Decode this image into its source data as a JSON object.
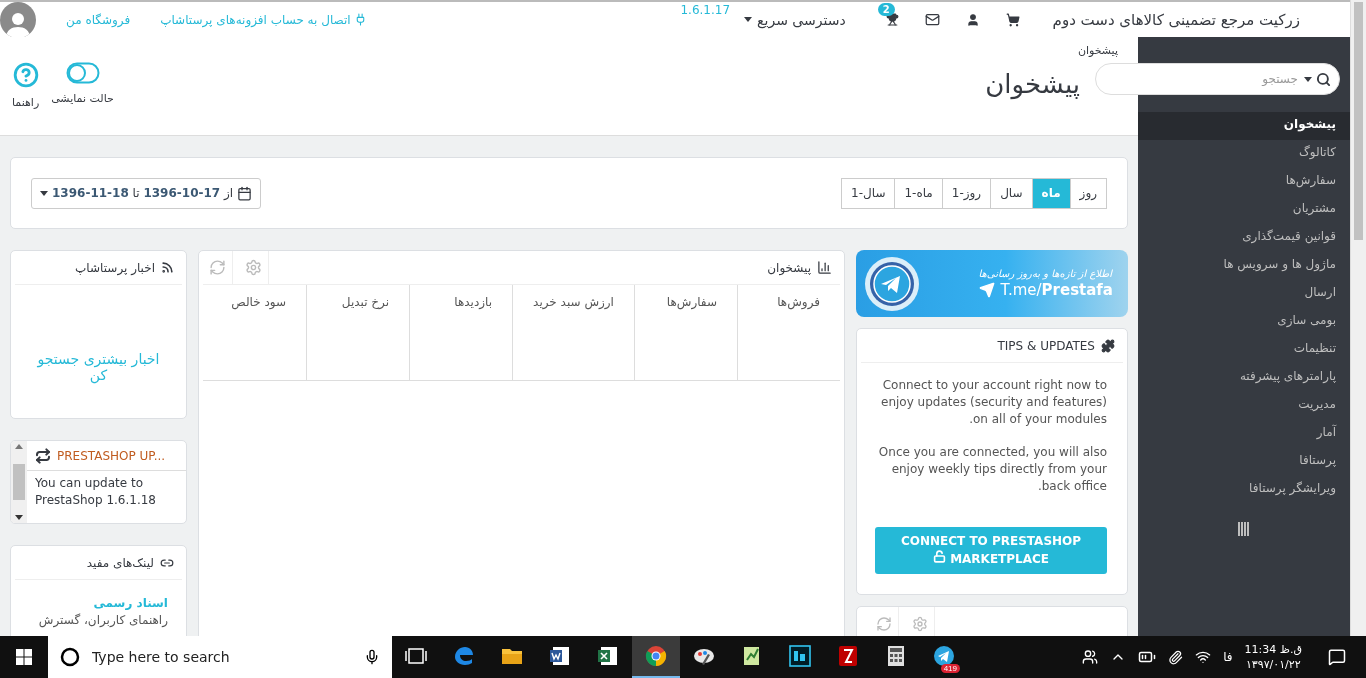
{
  "header": {
    "shop_name": "زرکیت مرجع تضمینی کالاهای دست دوم",
    "notification_count": "2",
    "quick_access": "دسترسی سریع",
    "version": "1.6.1.17",
    "connect_link": "اتصال به حساب افزونه‌های پرستاشاپ",
    "my_shop": "فروشگاه من"
  },
  "page_header": {
    "breadcrumb": "پیشخوان",
    "title": "پیشخوان",
    "toolbar": [
      {
        "kind": "toggle",
        "label": "حالت نمایشی"
      },
      {
        "kind": "help",
        "label": "راهنما"
      }
    ]
  },
  "sidebar": {
    "search_placeholder": "جستجو",
    "items": [
      {
        "label": "پیشخوان",
        "selected": true
      },
      {
        "label": "کاتالوگ",
        "selected": false
      },
      {
        "label": "سفارش‌ها",
        "selected": false
      },
      {
        "label": "مشتریان",
        "selected": false
      },
      {
        "label": "قوانین قیمت‌گذاری",
        "selected": false
      },
      {
        "label": "ماژول ها و سرویس ها",
        "selected": false
      },
      {
        "label": "ارسال",
        "selected": false
      },
      {
        "label": "بومی سازی",
        "selected": false
      },
      {
        "label": "تنظیمات",
        "selected": false
      },
      {
        "label": "پارامترهای پیشرفته",
        "selected": false
      },
      {
        "label": "مدیریت",
        "selected": false
      },
      {
        "label": "آمار",
        "selected": false
      },
      {
        "label": "پرستافا",
        "selected": false
      },
      {
        "label": "ویرایشگر پرستافا",
        "selected": false
      }
    ]
  },
  "date_bar": {
    "ranges": [
      {
        "label": "روز",
        "selected": false
      },
      {
        "label": "ماه",
        "selected": true
      },
      {
        "label": "سال",
        "selected": false
      },
      {
        "label": "روز-1",
        "selected": false
      },
      {
        "label": "ماه-1",
        "selected": false
      },
      {
        "label": "سال-1",
        "selected": false
      }
    ],
    "picker": "از **17-10-1396** تا **18-11-1396**"
  },
  "activity": {
    "title": "پیشخوان",
    "columns": [
      "فروش‌ها",
      "سفارش‌ها",
      "ارزش سبد خرید",
      "بازدیدها",
      "نرخ تبدیل",
      "سود خالص"
    ]
  },
  "news": {
    "title": "اخبار پرستاشاپ",
    "link": "اخبار بیشتری جستجو کن"
  },
  "update": {
    "title": "PRESTASHOP UP...",
    "text": "You can update to PrestaShop 1.6.1.18"
  },
  "links": {
    "title": "لینک‌های مفید",
    "items": [
      {
        "title": "اسناد رسمی",
        "text": "راهنمای کاربران، گسترش"
      }
    ]
  },
  "banner": {
    "tagline": "اطلاع از تازه‌ها و به‌روز رسانی‌ها",
    "link": "T.me/**Prestafa**"
  },
  "tips": {
    "title": "TIPS & UPDATES",
    "paragraphs": [
      "Connect to your account right now to enjoy updates (security and features) on all of your modules.",
      "Once you are connected, you will also enjoy weekly tips directly from your back office."
    ],
    "button": "CONNECT TO PRESTASHOP MARKETPLACE"
  },
  "taskbar": {
    "search_placeholder": "Type here to search",
    "apps": [
      {
        "kind": "edge",
        "selected": false
      },
      {
        "kind": "explorer",
        "selected": false
      },
      {
        "kind": "word",
        "selected": false
      },
      {
        "kind": "excel",
        "selected": false
      },
      {
        "kind": "chrome",
        "selected": true
      },
      {
        "kind": "paint",
        "selected": false
      },
      {
        "kind": "notepad",
        "selected": false
      },
      {
        "kind": "photoshop",
        "selected": false
      },
      {
        "kind": "filezilla",
        "selected": false
      },
      {
        "kind": "calculator",
        "selected": false
      },
      {
        "kind": "telegram",
        "selected": false,
        "badge": "419"
      }
    ],
    "language": "فا",
    "time": "ق.ظ 11:34",
    "date": "۱۳۹۷/۰۱/۲۲"
  }
}
